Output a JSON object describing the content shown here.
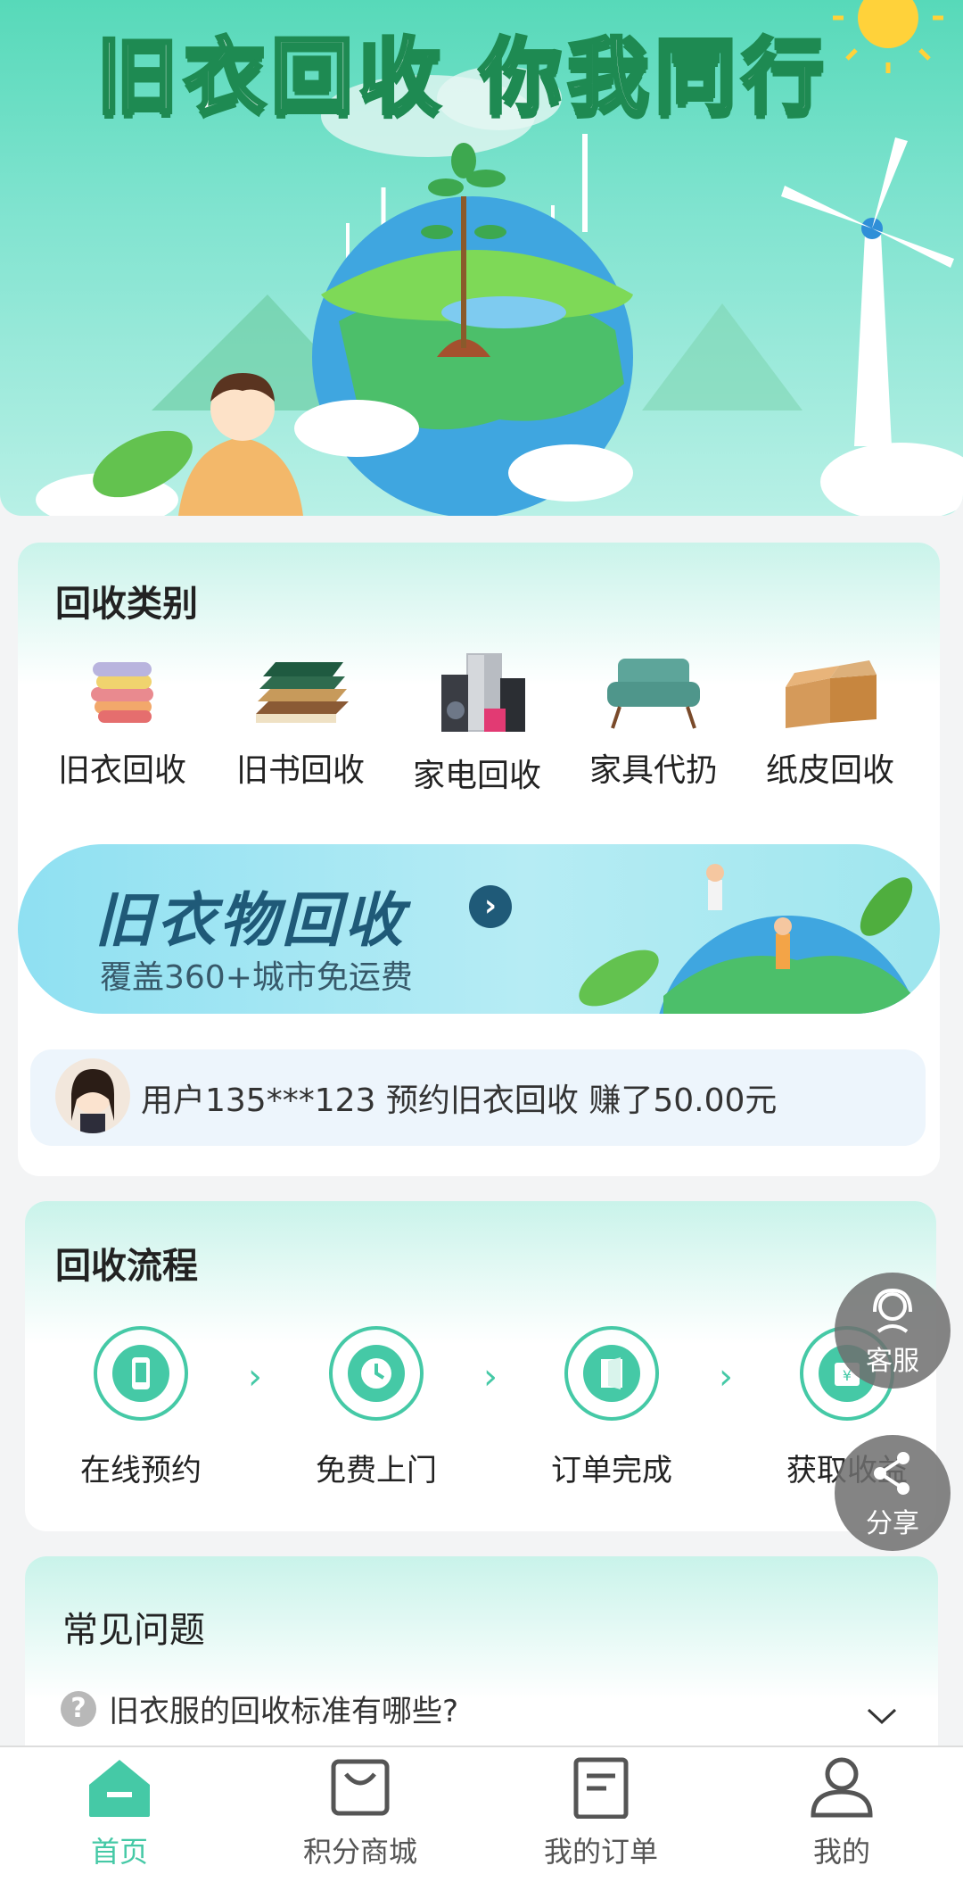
{
  "hero": {
    "title": "旧衣回收 你我同行"
  },
  "categories": {
    "title": "回收类别",
    "items": [
      {
        "label": "旧衣回收",
        "icon": "clothes-icon"
      },
      {
        "label": "旧书回收",
        "icon": "books-icon"
      },
      {
        "label": "家电回收",
        "icon": "appliances-icon"
      },
      {
        "label": "家具代扔",
        "icon": "sofa-icon"
      },
      {
        "label": "纸皮回收",
        "icon": "cardboard-icon"
      }
    ]
  },
  "promo": {
    "title": "旧衣物回收",
    "subtitle": "覆盖360+城市免运费"
  },
  "notice": {
    "text": "用户135***123 预约旧衣回收 赚了50.00元"
  },
  "process": {
    "title": "回收流程",
    "steps": [
      {
        "label": "在线预约",
        "icon": "phone-icon"
      },
      {
        "label": "免费上门",
        "icon": "clock-icon"
      },
      {
        "label": "订单完成",
        "icon": "door-icon"
      },
      {
        "label": "获取收益",
        "icon": "wallet-icon"
      }
    ]
  },
  "float": {
    "service": "客服",
    "share": "分享"
  },
  "faq": {
    "title": "常见问题",
    "question": "旧衣服的回收标准有哪些?"
  },
  "tabbar": {
    "tabs": [
      {
        "label": "首页",
        "icon": "home-icon"
      },
      {
        "label": "积分商城",
        "icon": "shop-bag-icon"
      },
      {
        "label": "我的订单",
        "icon": "order-icon"
      },
      {
        "label": "我的",
        "icon": "user-icon"
      }
    ]
  },
  "colors": {
    "accent": "#45c9a6",
    "hero": "#57d9b9",
    "promo_text": "#1f5a78"
  }
}
